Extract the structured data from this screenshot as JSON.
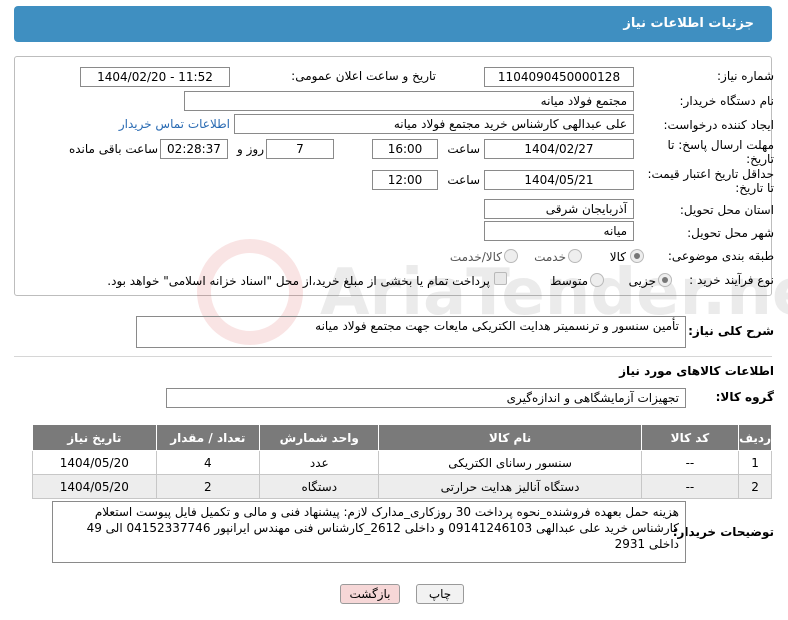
{
  "header": {
    "title": "جزئیات اطلاعات نیاز"
  },
  "need_number": {
    "label": "شماره نیاز:",
    "value": "1104090450000128"
  },
  "announce_datetime": {
    "label": "تاریخ و ساعت اعلان عمومی:",
    "value": "1404/02/20 - 11:52"
  },
  "buyer_org": {
    "label": "نام دستگاه خریدار:",
    "value": "مجتمع فولاد میانه"
  },
  "requester": {
    "label": "ایجاد کننده درخواست:",
    "value": "علی عبدالهی کارشناس خرید مجتمع فولاد میانه",
    "contact_link": "اطلاعات تماس خریدار"
  },
  "response_deadline": {
    "label_line1": "مهلت ارسال پاسخ: تا",
    "label_line2": "تاریخ:",
    "date": "1404/02/27",
    "time_label": "ساعت",
    "time": "16:00",
    "days": "7",
    "days_label": "روز و",
    "remaining": "02:28:37",
    "remaining_label": "ساعت باقی مانده"
  },
  "price_validity": {
    "label_line1": "حداقل تاریخ اعتبار قیمت:",
    "label_line2": "تا تاریخ:",
    "date": "1404/05/21",
    "time_label": "ساعت",
    "time": "12:00"
  },
  "delivery_province": {
    "label": "استان محل تحویل:",
    "value": "آذربایجان شرقی"
  },
  "delivery_city": {
    "label": "شهر محل تحویل:",
    "value": "میانه"
  },
  "category": {
    "label": "طبقه بندی موضوعی:",
    "options": [
      "کالا",
      "خدمت",
      "کالا/خدمت"
    ],
    "selected": "کالا"
  },
  "purchase_process": {
    "label": "نوع فرآیند خرید :",
    "options": [
      "جزیی",
      "متوسط"
    ],
    "selected": "جزیی",
    "payment_note": "پرداخت تمام یا بخشی از مبلغ خرید،از محل \"اسناد خزانه اسلامی\" خواهد بود."
  },
  "description": {
    "label": "شرح کلی نیاز:",
    "value": "تأمین سنسور و ترنسمیتر هدایت الکتریکی مایعات جهت مجتمع فولاد میانه"
  },
  "goods_section": {
    "title": "اطلاعات کالاهای مورد نیاز"
  },
  "goods_group": {
    "label": "گروه کالا:",
    "value": "تجهیزات آزمایشگاهی و اندازه‌گیری"
  },
  "table": {
    "headers": [
      "ردیف",
      "کد کالا",
      "نام کالا",
      "واحد شمارش",
      "تعداد / مقدار",
      "تاریخ نیاز"
    ],
    "rows": [
      [
        "1",
        "--",
        "سنسور رسانای الکتریکی",
        "عدد",
        "4",
        "1404/05/20"
      ],
      [
        "2",
        "--",
        "دستگاه آنالیز هدایت حرارتی",
        "دستگاه",
        "2",
        "1404/05/20"
      ]
    ]
  },
  "buyer_notes": {
    "label": "توضیحات خریدار:",
    "value": "هزینه حمل بعهده فروشنده_نحوه پرداخت 30 روزکاری_مدارک لازم: پیشنهاد فنی و مالی و تکمیل فایل پیوست استعلام کارشناس خرید علی عبدالهی 09141246103 و داخلی 2612_کارشناس فنی مهندس ایرانپور 04152337746 الی 49 داخلی 2931"
  },
  "buttons": {
    "print": "چاپ",
    "back": "بازگشت"
  },
  "watermark_text": "AriaTender.net",
  "colors": {
    "header_bg": "#3f8fc1",
    "table_header_bg": "#7a7a7a",
    "link": "#2a6bb3",
    "back_button_bg": "#f6d7d7"
  }
}
